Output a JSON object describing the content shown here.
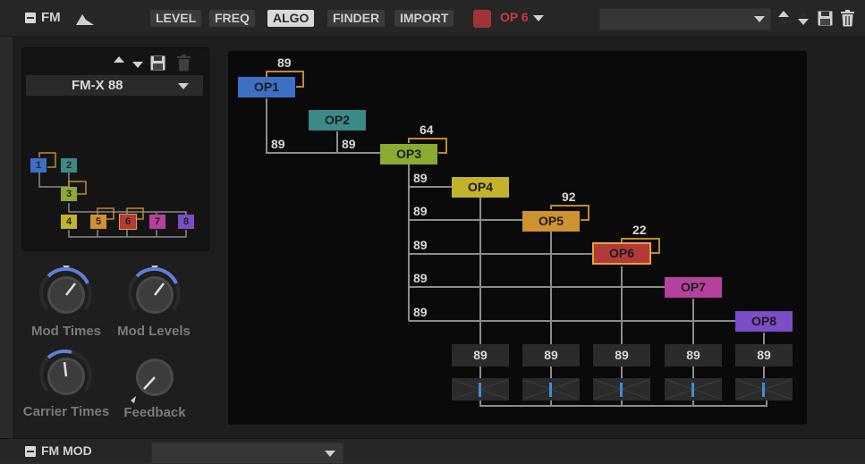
{
  "header": {
    "section_title": "FM",
    "tabs": [
      "LEVEL",
      "FREQ",
      "ALGO",
      "FINDER",
      "IMPORT"
    ],
    "active_tab": "ALGO",
    "operator_select": "OP 6",
    "preset_dropdown_value": ""
  },
  "algorithm_preset": {
    "name": "FM-X 88"
  },
  "mini_ops": [
    "1",
    "2",
    "3",
    "4",
    "5",
    "6",
    "7",
    "8"
  ],
  "knobs": {
    "mod_times": "Mod Times",
    "mod_levels": "Mod Levels",
    "carrier_times": "Carrier Times",
    "feedback": "Feedback"
  },
  "graph": {
    "operators": [
      {
        "label": "OP1",
        "color": "#3d6fc4"
      },
      {
        "label": "OP2",
        "color": "#3b8a88"
      },
      {
        "label": "OP3",
        "color": "#8aab32"
      },
      {
        "label": "OP4",
        "color": "#c2b32a"
      },
      {
        "label": "OP5",
        "color": "#cf9230"
      },
      {
        "label": "OP6",
        "color": "#b23b38"
      },
      {
        "label": "OP7",
        "color": "#b6409d"
      },
      {
        "label": "OP8",
        "color": "#7b4dc6"
      }
    ],
    "feedback_values": {
      "op1": "89",
      "op3": "64",
      "op5": "92",
      "op6": "22"
    },
    "mod_levels": {
      "op1_to_op3": "89",
      "op2_to_op3": "89",
      "op3_to_op4": "89",
      "op3_to_op5": "89",
      "op3_to_op6": "89",
      "op3_to_op7": "89",
      "op3_to_op8": "89"
    },
    "carrier_levels": [
      "89",
      "89",
      "89",
      "89",
      "89"
    ]
  },
  "fm_mod": {
    "section_title": "FM MOD",
    "dropdown_value": ""
  }
}
